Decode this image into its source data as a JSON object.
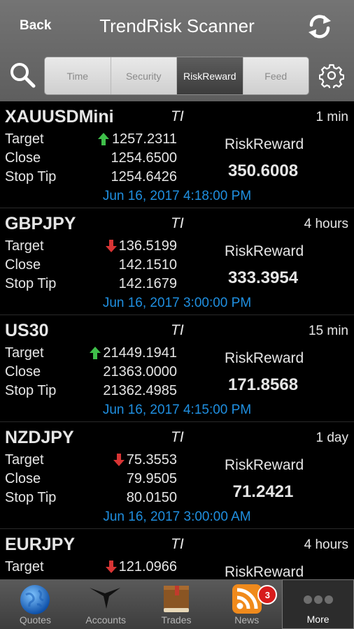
{
  "header": {
    "back_label": "Back",
    "title": "TrendRisk Scanner",
    "icons": {
      "refresh": "refresh-icon",
      "search": "search-icon",
      "settings": "gear-icon"
    }
  },
  "segments": [
    {
      "label": "Time",
      "active": false
    },
    {
      "label": "Security",
      "active": false
    },
    {
      "label": "RiskReward",
      "active": true
    },
    {
      "label": "Feed",
      "active": false
    }
  ],
  "row_labels": {
    "target": "Target",
    "close": "Close",
    "stop": "Stop Tip",
    "riskreward": "RiskReward"
  },
  "colors": {
    "up": "#3fbf4a",
    "down": "#d83434",
    "date": "#1f8fe0"
  },
  "cards": [
    {
      "symbol": "XAUUSDMini",
      "ti": "TI",
      "timeframe": "1 min",
      "direction": "up",
      "target": "1257.2311",
      "close": "1254.6500",
      "stop": "1254.6426",
      "riskreward": "350.6008",
      "date": "Jun 16, 2017 4:18:00 PM"
    },
    {
      "symbol": "GBPJPY",
      "ti": "TI",
      "timeframe": "4 hours",
      "direction": "down",
      "target": "136.5199",
      "close": "142.1510",
      "stop": "142.1679",
      "riskreward": "333.3954",
      "date": "Jun 16, 2017 3:00:00 PM"
    },
    {
      "symbol": "US30",
      "ti": "TI",
      "timeframe": "15 min",
      "direction": "up",
      "target": "21449.1941",
      "close": "21363.0000",
      "stop": "21362.4985",
      "riskreward": "171.8568",
      "date": "Jun 16, 2017 4:15:00 PM"
    },
    {
      "symbol": "NZDJPY",
      "ti": "TI",
      "timeframe": "1 day",
      "direction": "down",
      "target": "75.3553",
      "close": "79.9505",
      "stop": "80.0150",
      "riskreward": "71.2421",
      "date": "Jun 16, 2017 3:00:00 AM"
    },
    {
      "symbol": "EURJPY",
      "ti": "TI",
      "timeframe": "4 hours",
      "direction": "down",
      "target": "121.0966",
      "close": "",
      "stop": "",
      "riskreward": "",
      "date": ""
    }
  ],
  "tabbar": [
    {
      "label": "Quotes",
      "icon": "globe-icon"
    },
    {
      "label": "Accounts",
      "icon": "bird-logo-icon"
    },
    {
      "label": "Trades",
      "icon": "book-icon"
    },
    {
      "label": "News",
      "icon": "rss-icon",
      "badge": "3"
    },
    {
      "label": "More",
      "icon": "more-dots-icon",
      "active": true
    }
  ]
}
